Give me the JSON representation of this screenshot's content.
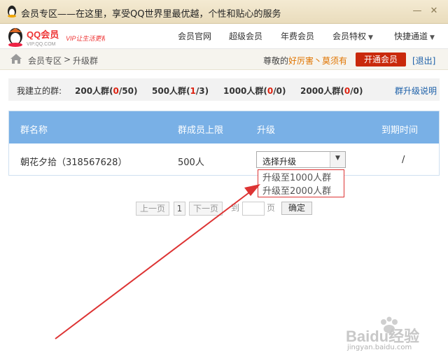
{
  "window": {
    "title": "会员专区——在这里，享受QQ世界里最优越，个性和贴心的服务",
    "minimize_glyph": "—",
    "close_glyph": "✕"
  },
  "logo": {
    "brand": "QQ会员",
    "domain": "VIP.QQ.COM",
    "slogan": "VIP让生活更精彩"
  },
  "nav": {
    "items": [
      {
        "label": "会员官网",
        "dropdown": false
      },
      {
        "label": "超级会员",
        "dropdown": false
      },
      {
        "label": "年费会员",
        "dropdown": false
      },
      {
        "label": "会员特权",
        "dropdown": true
      },
      {
        "label": "快捷通道",
        "dropdown": true
      }
    ]
  },
  "breadcrumb": {
    "home": "会员专区",
    "separator": ">",
    "current": "升级群"
  },
  "account": {
    "greeting": "尊敬的",
    "username": "好厉害丶莫须有",
    "open_button": "开通会员",
    "logout": "[退出]"
  },
  "stats": {
    "label": "我建立的群:",
    "groups": [
      {
        "name": "200人群",
        "used": "0",
        "total": "50"
      },
      {
        "name": "500人群",
        "used": "1",
        "total": "3"
      },
      {
        "name": "1000人群",
        "used": "0",
        "total": "0"
      },
      {
        "name": "2000人群",
        "used": "0",
        "total": "0"
      }
    ],
    "help": "群升级说明"
  },
  "table": {
    "headers": [
      "群名称",
      "群成员上限",
      "升级",
      "到期时间"
    ],
    "rows": [
      {
        "name": "朝花夕拾（318567628）",
        "limit": "500人",
        "expiry": "/"
      }
    ]
  },
  "upgrade_select": {
    "selected": "选择升级",
    "options": [
      "升级至1000人群",
      "升级至2000人群"
    ]
  },
  "pager": {
    "prev": "上一页",
    "current": "1",
    "next": "下一页",
    "goto": "到",
    "page_unit": "页",
    "confirm": "确定"
  },
  "watermark": {
    "logo_text": "Baidu经验",
    "url": "jingyan.baidu.com"
  },
  "colors": {
    "accent_red": "#c9290b",
    "header_blue": "#79b0e6",
    "annotation_red": "#dd3333"
  }
}
